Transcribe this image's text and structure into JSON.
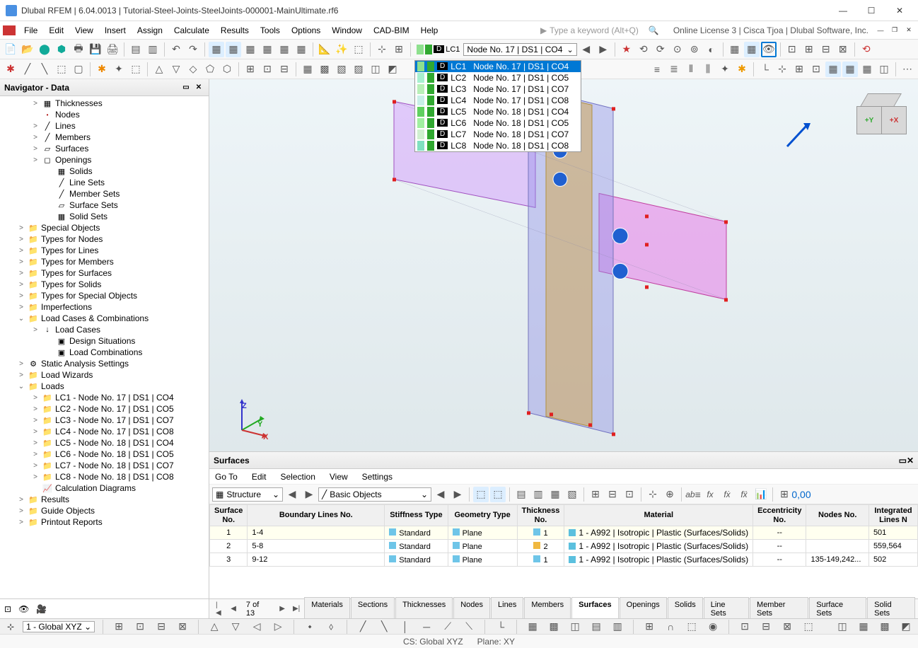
{
  "window": {
    "title": "Dlubal RFEM | 6.04.0013 | Tutorial-Steel-Joints-SteelJoints-000001-MainUltimate.rf6"
  },
  "menus": [
    "File",
    "Edit",
    "View",
    "Insert",
    "Assign",
    "Calculate",
    "Results",
    "Tools",
    "Options",
    "Window",
    "CAD-BIM",
    "Help"
  ],
  "search_placeholder": "Type a keyword (Alt+Q)",
  "license_text": "Online License 3 | Cisca Tjoa | Dlubal Software, Inc.",
  "lc_combo": {
    "current_lc": "LC1",
    "current_desc": "Node No. 17 | DS1 | CO4",
    "options": [
      {
        "lc": "LC1",
        "desc": "Node No. 17 | DS1 | CO4",
        "c1": "#8ee08e",
        "c2": "#30a830"
      },
      {
        "lc": "LC2",
        "desc": "Node No. 17 | DS1 | CO5",
        "c1": "#a8f0d0",
        "c2": "#30a830"
      },
      {
        "lc": "LC3",
        "desc": "Node No. 17 | DS1 | CO7",
        "c1": "#b8f0b8",
        "c2": "#30a830"
      },
      {
        "lc": "LC4",
        "desc": "Node No. 17 | DS1 | CO8",
        "c1": "#c8f0e8",
        "c2": "#30a830"
      },
      {
        "lc": "LC5",
        "desc": "Node No. 18 | DS1 | CO4",
        "c1": "#60d060",
        "c2": "#30a830"
      },
      {
        "lc": "LC6",
        "desc": "Node No. 18 | DS1 | CO5",
        "c1": "#a0f0a0",
        "c2": "#30a830"
      },
      {
        "lc": "LC7",
        "desc": "Node No. 18 | DS1 | CO7",
        "c1": "#d0f0d0",
        "c2": "#30a830"
      },
      {
        "lc": "LC8",
        "desc": "Node No. 18 | DS1 | CO8",
        "c1": "#80e0c0",
        "c2": "#30a830"
      }
    ]
  },
  "navigator": {
    "title": "Navigator - Data",
    "items": [
      {
        "indent": 2,
        "caret": ">",
        "icon": "▦",
        "label": "Thicknesses"
      },
      {
        "indent": 2,
        "caret": "",
        "icon": "•",
        "label": "Nodes",
        "iconClass": "dot"
      },
      {
        "indent": 2,
        "caret": ">",
        "icon": "╱",
        "label": "Lines"
      },
      {
        "indent": 2,
        "caret": ">",
        "icon": "╱",
        "label": "Members"
      },
      {
        "indent": 2,
        "caret": ">",
        "icon": "▱",
        "label": "Surfaces"
      },
      {
        "indent": 2,
        "caret": ">",
        "icon": "◻",
        "label": "Openings"
      },
      {
        "indent": 3,
        "caret": "",
        "icon": "▦",
        "label": "Solids"
      },
      {
        "indent": 3,
        "caret": "",
        "icon": "╱",
        "label": "Line Sets"
      },
      {
        "indent": 3,
        "caret": "",
        "icon": "╱",
        "label": "Member Sets"
      },
      {
        "indent": 3,
        "caret": "",
        "icon": "▱",
        "label": "Surface Sets"
      },
      {
        "indent": 3,
        "caret": "",
        "icon": "▦",
        "label": "Solid Sets"
      },
      {
        "indent": 1,
        "caret": ">",
        "icon": "📁",
        "label": "Special Objects",
        "iconClass": "folder"
      },
      {
        "indent": 1,
        "caret": ">",
        "icon": "📁",
        "label": "Types for Nodes",
        "iconClass": "folder"
      },
      {
        "indent": 1,
        "caret": ">",
        "icon": "📁",
        "label": "Types for Lines",
        "iconClass": "folder"
      },
      {
        "indent": 1,
        "caret": ">",
        "icon": "📁",
        "label": "Types for Members",
        "iconClass": "folder"
      },
      {
        "indent": 1,
        "caret": ">",
        "icon": "📁",
        "label": "Types for Surfaces",
        "iconClass": "folder"
      },
      {
        "indent": 1,
        "caret": ">",
        "icon": "📁",
        "label": "Types for Solids",
        "iconClass": "folder"
      },
      {
        "indent": 1,
        "caret": ">",
        "icon": "📁",
        "label": "Types for Special Objects",
        "iconClass": "folder"
      },
      {
        "indent": 1,
        "caret": ">",
        "icon": "📁",
        "label": "Imperfections",
        "iconClass": "folder"
      },
      {
        "indent": 1,
        "caret": "⌄",
        "icon": "📁",
        "label": "Load Cases & Combinations",
        "iconClass": "folder"
      },
      {
        "indent": 2,
        "caret": ">",
        "icon": "↓",
        "label": "Load Cases"
      },
      {
        "indent": 3,
        "caret": "",
        "icon": "▣",
        "label": "Design Situations"
      },
      {
        "indent": 3,
        "caret": "",
        "icon": "▣",
        "label": "Load Combinations"
      },
      {
        "indent": 1,
        "caret": ">",
        "icon": "⚙",
        "label": "Static Analysis Settings"
      },
      {
        "indent": 1,
        "caret": ">",
        "icon": "📁",
        "label": "Load Wizards",
        "iconClass": "folder"
      },
      {
        "indent": 1,
        "caret": "⌄",
        "icon": "📁",
        "label": "Loads",
        "iconClass": "folder"
      },
      {
        "indent": 2,
        "caret": ">",
        "icon": "📁",
        "label": "LC1 - Node No. 17 | DS1 | CO4",
        "iconClass": "folder"
      },
      {
        "indent": 2,
        "caret": ">",
        "icon": "📁",
        "label": "LC2 - Node No. 17 | DS1 | CO5",
        "iconClass": "folder"
      },
      {
        "indent": 2,
        "caret": ">",
        "icon": "📁",
        "label": "LC3 - Node No. 17 | DS1 | CO7",
        "iconClass": "folder"
      },
      {
        "indent": 2,
        "caret": ">",
        "icon": "📁",
        "label": "LC4 - Node No. 17 | DS1 | CO8",
        "iconClass": "folder"
      },
      {
        "indent": 2,
        "caret": ">",
        "icon": "📁",
        "label": "LC5 - Node No. 18 | DS1 | CO4",
        "iconClass": "folder"
      },
      {
        "indent": 2,
        "caret": ">",
        "icon": "📁",
        "label": "LC6 - Node No. 18 | DS1 | CO5",
        "iconClass": "folder"
      },
      {
        "indent": 2,
        "caret": ">",
        "icon": "📁",
        "label": "LC7 - Node No. 18 | DS1 | CO7",
        "iconClass": "folder"
      },
      {
        "indent": 2,
        "caret": ">",
        "icon": "📁",
        "label": "LC8 - Node No. 18 | DS1 | CO8",
        "iconClass": "folder"
      },
      {
        "indent": 2,
        "caret": "",
        "icon": "📈",
        "label": "Calculation Diagrams"
      },
      {
        "indent": 1,
        "caret": ">",
        "icon": "📁",
        "label": "Results",
        "iconClass": "folder"
      },
      {
        "indent": 1,
        "caret": ">",
        "icon": "📁",
        "label": "Guide Objects",
        "iconClass": "folder"
      },
      {
        "indent": 1,
        "caret": ">",
        "icon": "📁",
        "label": "Printout Reports",
        "iconClass": "folder"
      }
    ]
  },
  "surfaces_panel": {
    "title": "Surfaces",
    "menus": [
      "Go To",
      "Edit",
      "Selection",
      "View",
      "Settings"
    ],
    "combo1": "Structure",
    "combo2": "Basic Objects",
    "headers": {
      "surface_no": "Surface\nNo.",
      "boundary": "Boundary Lines No.",
      "stiffness": "Stiffness Type",
      "geometry": "Geometry Type",
      "thickness": "Thickness\nNo.",
      "material": "Material",
      "eccentricity": "Eccentricity\nNo.",
      "nodes": "Nodes No.",
      "integrated": "Integrated\nLines N"
    },
    "rows": [
      {
        "no": "1",
        "boundary": "1-4",
        "stiff": "Standard",
        "geom": "Plane",
        "thick": "1",
        "mat": "1 - A992 | Isotropic | Plastic (Surfaces/Solids)",
        "ecc": "--",
        "nodes": "",
        "lines": "501"
      },
      {
        "no": "2",
        "boundary": "5-8",
        "stiff": "Standard",
        "geom": "Plane",
        "thick": "2",
        "mat": "1 - A992 | Isotropic | Plastic (Surfaces/Solids)",
        "ecc": "--",
        "nodes": "",
        "lines": "559,564"
      },
      {
        "no": "3",
        "boundary": "9-12",
        "stiff": "Standard",
        "geom": "Plane",
        "thick": "1",
        "mat": "1 - A992 | Isotropic | Plastic (Surfaces/Solids)",
        "ecc": "--",
        "nodes": "135-149,242...",
        "lines": "502"
      }
    ],
    "page_info": "7 of 13",
    "tabs": [
      "Materials",
      "Sections",
      "Thicknesses",
      "Nodes",
      "Lines",
      "Members",
      "Surfaces",
      "Openings",
      "Solids",
      "Line Sets",
      "Member Sets",
      "Surface Sets",
      "Solid Sets"
    ],
    "active_tab": "Surfaces",
    "thick_colors": [
      "#6ec5e8",
      "#f0b840",
      "#6ec5e8"
    ]
  },
  "statusbar": {
    "cs_combo": "1 - Global XYZ",
    "cs_label": "CS: Global XYZ",
    "plane_label": "Plane: XY"
  },
  "viewcube": {
    "front": "+Y",
    "right": "+X"
  }
}
